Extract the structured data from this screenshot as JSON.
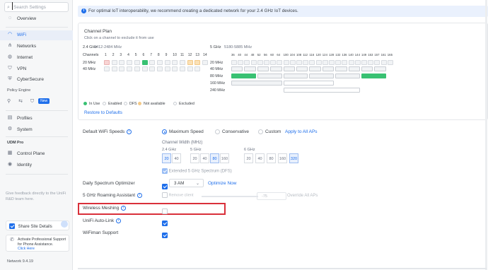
{
  "sidebar": {
    "search_placeholder": "Search Settings",
    "items": [
      {
        "label": "Overview",
        "icon": "overview-icon",
        "glyph": "◌"
      },
      {
        "label": "WiFi",
        "icon": "wifi-icon",
        "glyph": "◠"
      },
      {
        "label": "Networks",
        "icon": "networks-icon",
        "glyph": "⋔"
      },
      {
        "label": "Internet",
        "icon": "internet-icon",
        "glyph": "◍"
      },
      {
        "label": "VPN",
        "icon": "vpn-icon",
        "glyph": "⛉"
      },
      {
        "label": "CyberSecure",
        "icon": "cybersecure-icon",
        "glyph": "⛨"
      },
      {
        "label": "Profiles",
        "icon": "profiles-icon",
        "glyph": "▤"
      },
      {
        "label": "System",
        "icon": "system-icon",
        "glyph": "⚙"
      },
      {
        "label": "Control Plane",
        "icon": "control-plane-icon",
        "glyph": "▦"
      },
      {
        "label": "Identity",
        "icon": "identity-icon",
        "glyph": "◉"
      }
    ],
    "policy_engine": "Policy Engine",
    "new_badge": "New",
    "udm_pro": "UDM Pro",
    "feedback": "Give feedback directly to the UniFi R&D team here.",
    "share_site_details": "Share Site Details",
    "support_text": "Activate Professional Support for Phone Assistance.",
    "support_link": "Click Here",
    "version": "Network 9.4.19"
  },
  "banner": "For optimal IoT interoperability, we recommend creating a dedicated network for your 2.4 GHz IoT devices.",
  "channel_plan": {
    "title": "Channel Plan",
    "subtitle": "Click on a channel to exclude it from use",
    "band24": {
      "label": "2.4 GHz",
      "range": "2412-2484 MHz",
      "channels": [
        "1",
        "2",
        "3",
        "4",
        "5",
        "6",
        "7",
        "8",
        "9",
        "10",
        "11",
        "12",
        "13",
        "14"
      ],
      "rows": [
        "Channels",
        "20 MHz",
        "40 MHz"
      ]
    },
    "band5": {
      "label": "5 GHz",
      "range": "5180-5885 MHz",
      "channels": [
        "36",
        "40",
        "44",
        "48",
        "52",
        "56",
        "60",
        "64",
        "100",
        "104",
        "108",
        "112",
        "116",
        "120",
        "124",
        "128",
        "132",
        "136",
        "140",
        "144",
        "149",
        "153",
        "157",
        "161",
        "165"
      ],
      "rows": [
        "20 MHz",
        "40 MHz",
        "80 MHz",
        "160 MHz",
        "240 MHz"
      ]
    },
    "legend": [
      "In Use",
      "Enabled",
      "DFS",
      "Not available",
      "Excluded"
    ],
    "restore": "Restore to Defaults"
  },
  "settings": {
    "default_speeds_label": "Default WiFi Speeds",
    "speed_options": [
      "Maximum Speed",
      "Conservative",
      "Custom"
    ],
    "apply_all": "Apply to All APs",
    "channel_width_label": "Channel Width (MHz)",
    "w24_label": "2.4 GHz",
    "w24": [
      "20",
      "40"
    ],
    "w5_label": "5 GHz",
    "w5": [
      "20",
      "40",
      "80",
      "160"
    ],
    "w6_label": "6 GHz",
    "w6": [
      "20",
      "40",
      "80",
      "160",
      "320"
    ],
    "extended_spectrum": "Extended 5 GHz Spectrum (DFS)",
    "spectrum_optimizer_label": "Daily Spectrum Optimizer",
    "optimizer_time": "3 AM",
    "optimize_now": "Optimize Now",
    "roaming_label": "5 GHz Roaming Assistant",
    "roaming_mode": "Remove client",
    "roaming_value": "-75",
    "override_all": "Override All APs",
    "wireless_meshing_label": "Wireless Meshing",
    "auto_link_label": "UniFi Auto-Link",
    "wifiman_label": "WiFiman Support"
  },
  "colors": {
    "accent": "#1f6feb",
    "in_use": "#38c172",
    "not_available": "#f3c987",
    "highlight": "#d9303a"
  }
}
